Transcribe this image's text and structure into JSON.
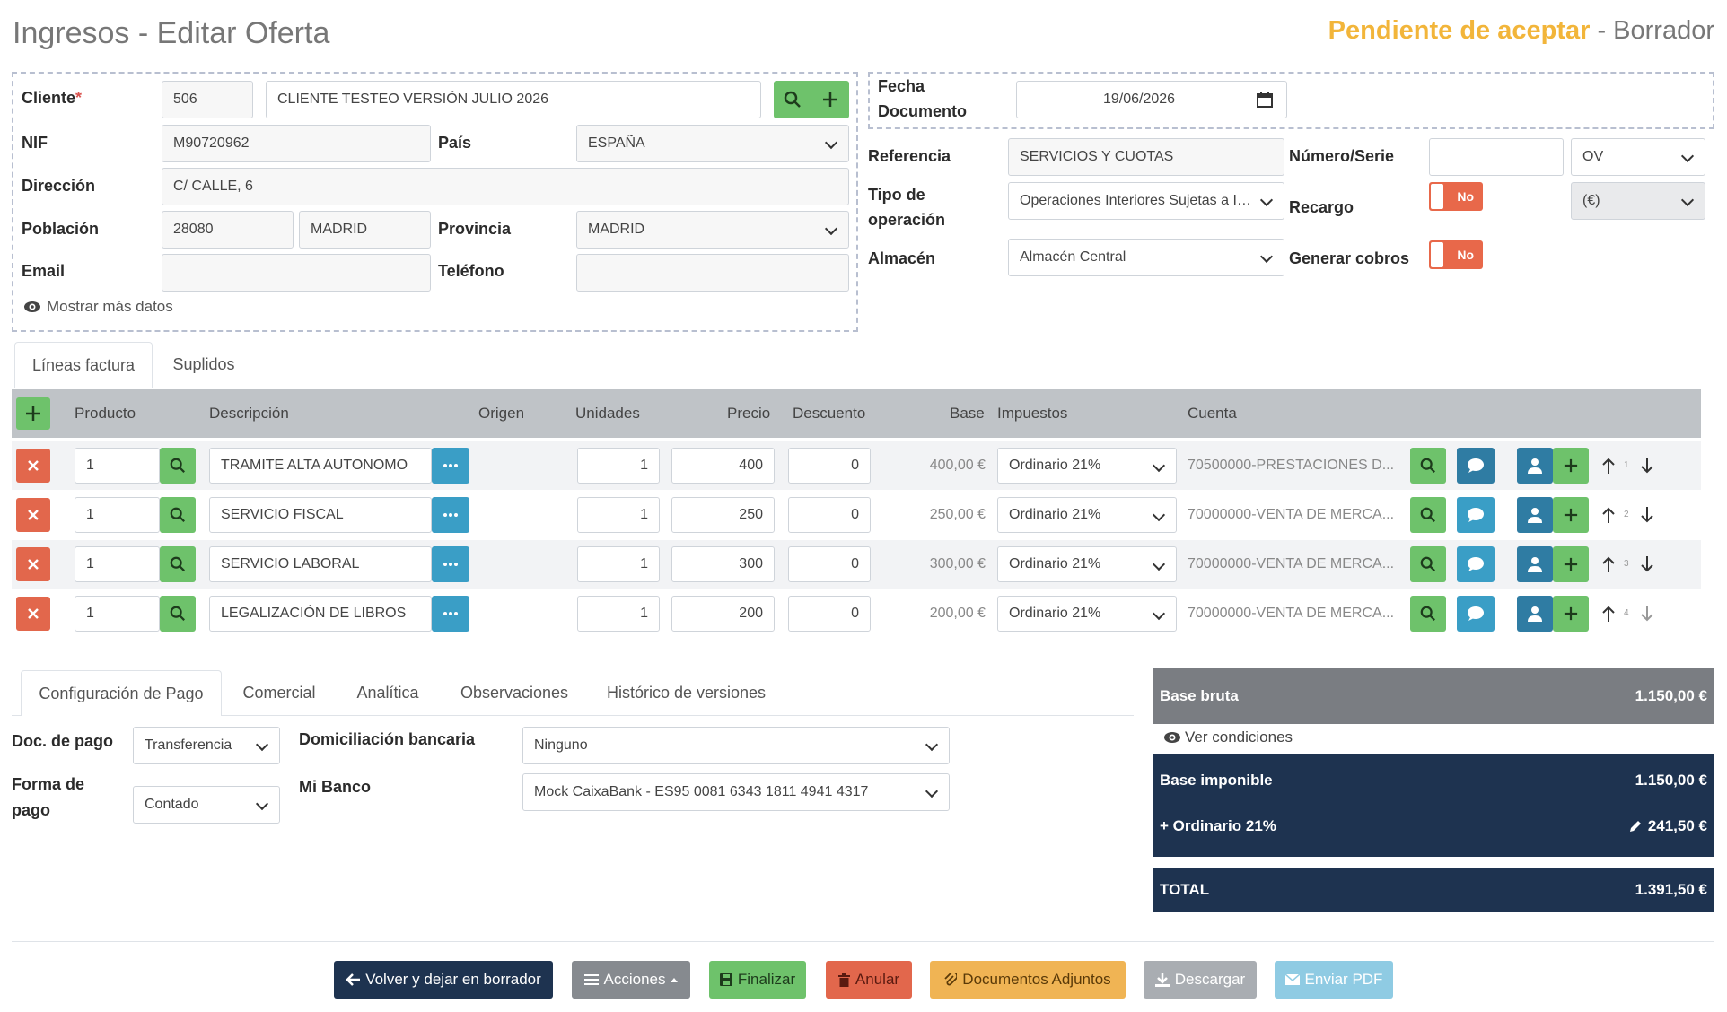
{
  "header": {
    "title": "Ingresos - Editar Oferta",
    "status": "Pendiente de aceptar",
    "separator": " - ",
    "state": "Borrador"
  },
  "client": {
    "cliente_label": "Cliente",
    "required_mark": "*",
    "cliente_code": "506",
    "cliente_name": "CLIENTE TESTEO VERSIÓN JULIO 2026",
    "nif_label": "NIF",
    "nif": "M90720962",
    "pais_label": "País",
    "pais": "ESPAÑA",
    "direccion_label": "Dirección",
    "direccion": "C/ CALLE, 6",
    "poblacion_label": "Población",
    "cp": "28080",
    "poblacion": "MADRID",
    "provincia_label": "Provincia",
    "provincia": "MADRID",
    "email_label": "Email",
    "email": "",
    "telefono_label": "Teléfono",
    "telefono": "",
    "more_link": "Mostrar más datos"
  },
  "document": {
    "fecha_label_1": "Fecha",
    "fecha_label_2": "Documento",
    "fecha": "19/06/2026",
    "referencia_label": "Referencia",
    "referencia": "SERVICIOS Y CUOTAS",
    "numero_label": "Número/Serie",
    "numero": "",
    "serie": "OV",
    "tipo_label_1": "Tipo de",
    "tipo_label_2": "operación",
    "tipo": "Operaciones Interiores Sujetas a IVA",
    "recargo_label": "Recargo",
    "recargo_toggle": "No",
    "recargo_value": "(€)",
    "almacen_label": "Almacén",
    "almacen": "Almacén Central",
    "cobros_label": "Generar cobros",
    "cobros_toggle": "No"
  },
  "line_tabs": [
    "Líneas factura",
    "Suplidos"
  ],
  "table": {
    "headers": {
      "producto": "Producto",
      "descripcion": "Descripción",
      "origen": "Origen",
      "unidades": "Unidades",
      "precio": "Precio",
      "descuento": "Descuento",
      "base": "Base",
      "impuestos": "Impuestos",
      "cuenta": "Cuenta"
    },
    "rows": [
      {
        "producto": "1",
        "descripcion": "TRAMITE ALTA AUTONOMO",
        "unidades": "1",
        "precio": "400",
        "descuento": "0",
        "base": "400,00 €",
        "impuesto": "Ordinario 21%",
        "cuenta": "70500000-PRESTACIONES D...",
        "orden": "1"
      },
      {
        "producto": "1",
        "descripcion": "SERVICIO FISCAL",
        "unidades": "1",
        "precio": "250",
        "descuento": "0",
        "base": "250,00 €",
        "impuesto": "Ordinario 21%",
        "cuenta": "70000000-VENTA DE MERCA...",
        "orden": "2"
      },
      {
        "producto": "1",
        "descripcion": "SERVICIO LABORAL",
        "unidades": "1",
        "precio": "300",
        "descuento": "0",
        "base": "300,00 €",
        "impuesto": "Ordinario 21%",
        "cuenta": "70000000-VENTA DE MERCA...",
        "orden": "3"
      },
      {
        "producto": "1",
        "descripcion": "LEGALIZACIÓN DE LIBROS",
        "unidades": "1",
        "precio": "200",
        "descuento": "0",
        "base": "200,00 €",
        "impuesto": "Ordinario 21%",
        "cuenta": "70000000-VENTA DE MERCA...",
        "orden": "4"
      }
    ]
  },
  "bottom_tabs": [
    "Configuración de Pago",
    "Comercial",
    "Analítica",
    "Observaciones",
    "Histórico de versiones"
  ],
  "payment": {
    "doc_label": "Doc. de pago",
    "doc": "Transferencia",
    "forma_label_1": "Forma de",
    "forma_label_2": "pago",
    "forma": "Contado",
    "domiciliacion_label": "Domiciliación bancaria",
    "domiciliacion": "Ninguno",
    "banco_label": "Mi Banco",
    "banco": "Mock CaixaBank - ES95 0081 6343 1811 4941 4317"
  },
  "totals": {
    "base_bruta_label": "Base bruta",
    "base_bruta": "1.150,00 €",
    "ver_condiciones": "Ver condiciones",
    "base_imponible_label": "Base imponible",
    "base_imponible": "1.150,00 €",
    "impuesto_label": "+ Ordinario 21%",
    "impuesto": "241,50 €",
    "total_label": "TOTAL",
    "total": "1.391,50 €"
  },
  "footer": {
    "volver": "Volver y dejar en borrador",
    "acciones": "Acciones",
    "finalizar": "Finalizar",
    "anular": "Anular",
    "adjuntos": "Documentos Adjuntos",
    "descargar": "Descargar",
    "enviar": "Enviar PDF"
  },
  "colors": {
    "status": "#f2b53a",
    "navy": "#1e3350",
    "green": "#6ec26b",
    "teal": "#3a9ec6",
    "red": "#e2674c",
    "table_header": "#bfc3c7"
  }
}
